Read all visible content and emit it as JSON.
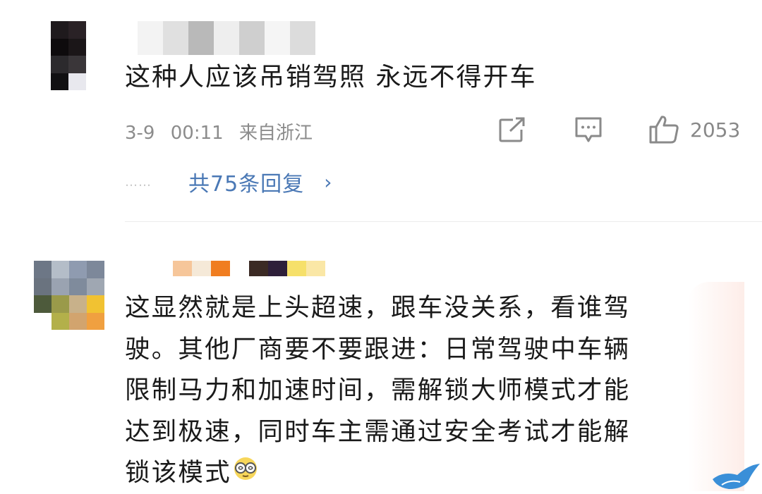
{
  "comments": [
    {
      "avatar_pixels": [
        "#1f1a1d",
        "#2a2226",
        "#0e0b0d",
        "#1b1618",
        "#2c2a2d",
        "#3a3639",
        "#111012",
        "#e8e8ee"
      ],
      "username_pixels": [
        "#f3f3f3",
        "#e0e0e0",
        "#b9b9b9",
        "#eeeeee",
        "#cfcfcf",
        "#f5f5f5",
        "#dcdcdc"
      ],
      "text": "这种人应该吊销驾照 永远不得开车",
      "date": "3-9",
      "time": "00:11",
      "location": "来自浙江",
      "share_icon": "share-icon",
      "reply_icon": "comment-icon",
      "like_icon": "thumbs-up-icon",
      "likes": "2053",
      "replies_label": "共75条回复",
      "chevron": "›"
    },
    {
      "avatar_pixels": [
        "#6d7786",
        "#b4bdc8",
        "#8f9bb0",
        "#7d889a",
        "#6a737f",
        "#9aa3b1",
        "#7f8b9c",
        "#9fa7b2",
        "#4d5a3b",
        "#9a9a4a",
        "#c8b18a",
        "#f1c232",
        "#ffffff",
        "#b3b04a",
        "#d2a46e",
        "#f0a040"
      ],
      "username_pixels": [
        "#ffffff",
        "#f6c69a",
        "#f5e9d8",
        "#f07d20",
        "#ffffff",
        "#3b2a24",
        "#2e1f3a",
        "#f6e06a",
        "#fae7a6"
      ],
      "lines": [
        "这显然就是上头超速，跟车没关系，看谁驾",
        "驶。其他厂商要不要跟进：日常驾驶中车辆",
        "限制马力和加速时间，需解锁大师模式才能",
        "达到极速，同时车主需通过安全考试才能解",
        "锁该模式"
      ],
      "emoji_icon": "dizzy-glasses-emoji-icon"
    }
  ],
  "colors": {
    "link_blue": "#4a78b5",
    "meta_gray": "#8c8c8c",
    "text_dark": "#1a1a1a",
    "corner_blue": "#3a8fd8"
  }
}
